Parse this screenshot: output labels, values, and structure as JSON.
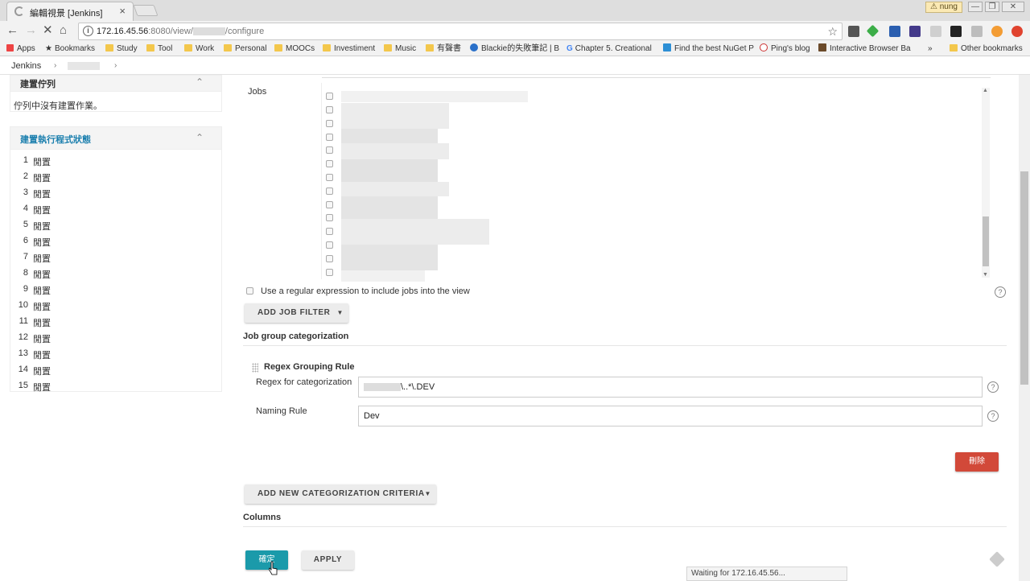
{
  "browser": {
    "tab_title": "編輯視景 [Jenkins]",
    "tab_close": "×",
    "user_badge": "⚠ nung",
    "window_controls": [
      "—",
      "❐",
      "✕"
    ],
    "url_host": "172.16.45.56",
    "url_rest_prefix": ":8080/view/",
    "url_rest_suffix": "/configure",
    "bookmarks": [
      {
        "label": "Apps",
        "kind": "apps"
      },
      {
        "label": "Bookmarks",
        "kind": "star"
      },
      {
        "label": "Study",
        "kind": "folder"
      },
      {
        "label": "Tool",
        "kind": "folder"
      },
      {
        "label": "Work",
        "kind": "folder"
      },
      {
        "label": "Personal",
        "kind": "folder"
      },
      {
        "label": "MOOCs",
        "kind": "folder"
      },
      {
        "label": "Investiment",
        "kind": "folder"
      },
      {
        "label": "Music",
        "kind": "folder"
      },
      {
        "label": "有聲書",
        "kind": "folder"
      },
      {
        "label": "Blackie的失敗筆記 | B",
        "kind": "site"
      },
      {
        "label": "Chapter 5. Creational",
        "kind": "site"
      },
      {
        "label": "Find the best NuGet P",
        "kind": "site"
      },
      {
        "label": "Ping's blog",
        "kind": "site"
      },
      {
        "label": "Interactive Browser Ba",
        "kind": "site"
      }
    ],
    "bookmarks_more": "»",
    "other_bookmarks": "Other bookmarks"
  },
  "breadcrumb": {
    "root": "Jenkins",
    "sep": "›"
  },
  "build_queue": {
    "title": "建置佇列",
    "empty_text": "佇列中沒有建置作業。"
  },
  "executors": {
    "title": "建置執行程式狀態",
    "items": [
      {
        "num": "1",
        "state": "閒置"
      },
      {
        "num": "2",
        "state": "閒置"
      },
      {
        "num": "3",
        "state": "閒置"
      },
      {
        "num": "4",
        "state": "閒置"
      },
      {
        "num": "5",
        "state": "閒置"
      },
      {
        "num": "6",
        "state": "閒置"
      },
      {
        "num": "7",
        "state": "閒置"
      },
      {
        "num": "8",
        "state": "閒置"
      },
      {
        "num": "9",
        "state": "閒置"
      },
      {
        "num": "10",
        "state": "閒置"
      },
      {
        "num": "11",
        "state": "閒置"
      },
      {
        "num": "12",
        "state": "閒置"
      },
      {
        "num": "13",
        "state": "閒置"
      },
      {
        "num": "14",
        "state": "閒置"
      },
      {
        "num": "15",
        "state": "閒置"
      }
    ]
  },
  "form": {
    "jobs_label": "Jobs",
    "regex_include_label": "Use a regular expression to include jobs into the view",
    "add_job_filter": "ADD JOB FILTER",
    "job_group_title": "Job group categorization",
    "rule_title": "Regex Grouping Rule",
    "regex_label": "Regex for categorization",
    "regex_value_suffix": "\\..*\\.DEV",
    "naming_label": "Naming Rule",
    "naming_value": "Dev",
    "delete_button": "刪除",
    "add_criteria": "ADD NEW CATEGORIZATION CRITERIA",
    "columns_title": "Columns",
    "save_button": "確定",
    "apply_button": "APPLY",
    "help": "?"
  },
  "status_bar": "Waiting for 172.16.45.56...",
  "colors": {
    "accent": "#1b9aaa",
    "danger": "#d24939",
    "link": "#1b7fae"
  }
}
